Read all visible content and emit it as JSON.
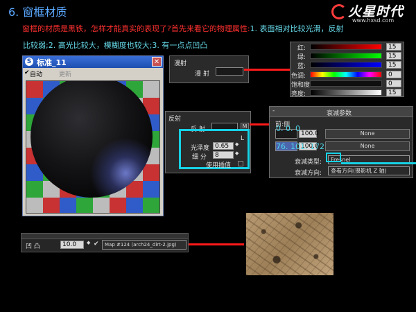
{
  "heading": "6. 窗框材质",
  "logo": {
    "name": "火星时代",
    "url": "www.hxsd.com"
  },
  "intro": {
    "line1_red": "窗框的材质是黑铁，怎样才能真实的表现了?首先来看它的物理属性:",
    "line1_cyan": "1. 表面相对比较光滑，反射",
    "line2": "比较弱;2. 高光比较大，模糊度也较大;3. 有一点点凹凸"
  },
  "material_window": {
    "title": "标准_11",
    "menu_auto": "自动",
    "menu_update": "更新",
    "checker_colors": [
      "#c83232",
      "#2f5cc8",
      "#2ea63a",
      "#bcbcbc",
      "#c83232",
      "#2f5cc8",
      "#2ea63a",
      "#bcbcbc"
    ]
  },
  "diffuse_panel": {
    "group": "漫射",
    "label": "漫 射"
  },
  "color_panel": {
    "rows": [
      {
        "label": "红:",
        "value": "15"
      },
      {
        "label": "绿:",
        "value": "15"
      },
      {
        "label": "蓝:",
        "value": "15"
      },
      {
        "label": "色调:",
        "value": "0"
      },
      {
        "label": "饱和度:",
        "value": "0"
      },
      {
        "label": "亮度:",
        "value": "15"
      }
    ]
  },
  "reflect_panel": {
    "group": "反射",
    "label": "反 射",
    "m_button": "M",
    "gloss_label": "光泽度",
    "gloss_value": "0.65",
    "subdiv_label": "细 分",
    "subdiv_value": "8",
    "interp_label": "使用插值",
    "l_label": "L"
  },
  "falloff_panel": {
    "title": "衰减参数",
    "front_side": "前:侧",
    "value_a": "100.0",
    "value_b": "100.0",
    "none_a": "None",
    "none_b": "None",
    "type_label": "衰减类型:",
    "type_value": "Fresnel",
    "dir_label": "衰减方向:",
    "dir_value": "查看方向(摄影机 Z 轴)",
    "rgb_top": "0. 0. 0",
    "rgb_bottom": "76. 101. 172"
  },
  "bump_row": {
    "label": "凹 凸",
    "value": "10.0",
    "map": "Map #124 (arch24_dirt-2.jpg)"
  }
}
